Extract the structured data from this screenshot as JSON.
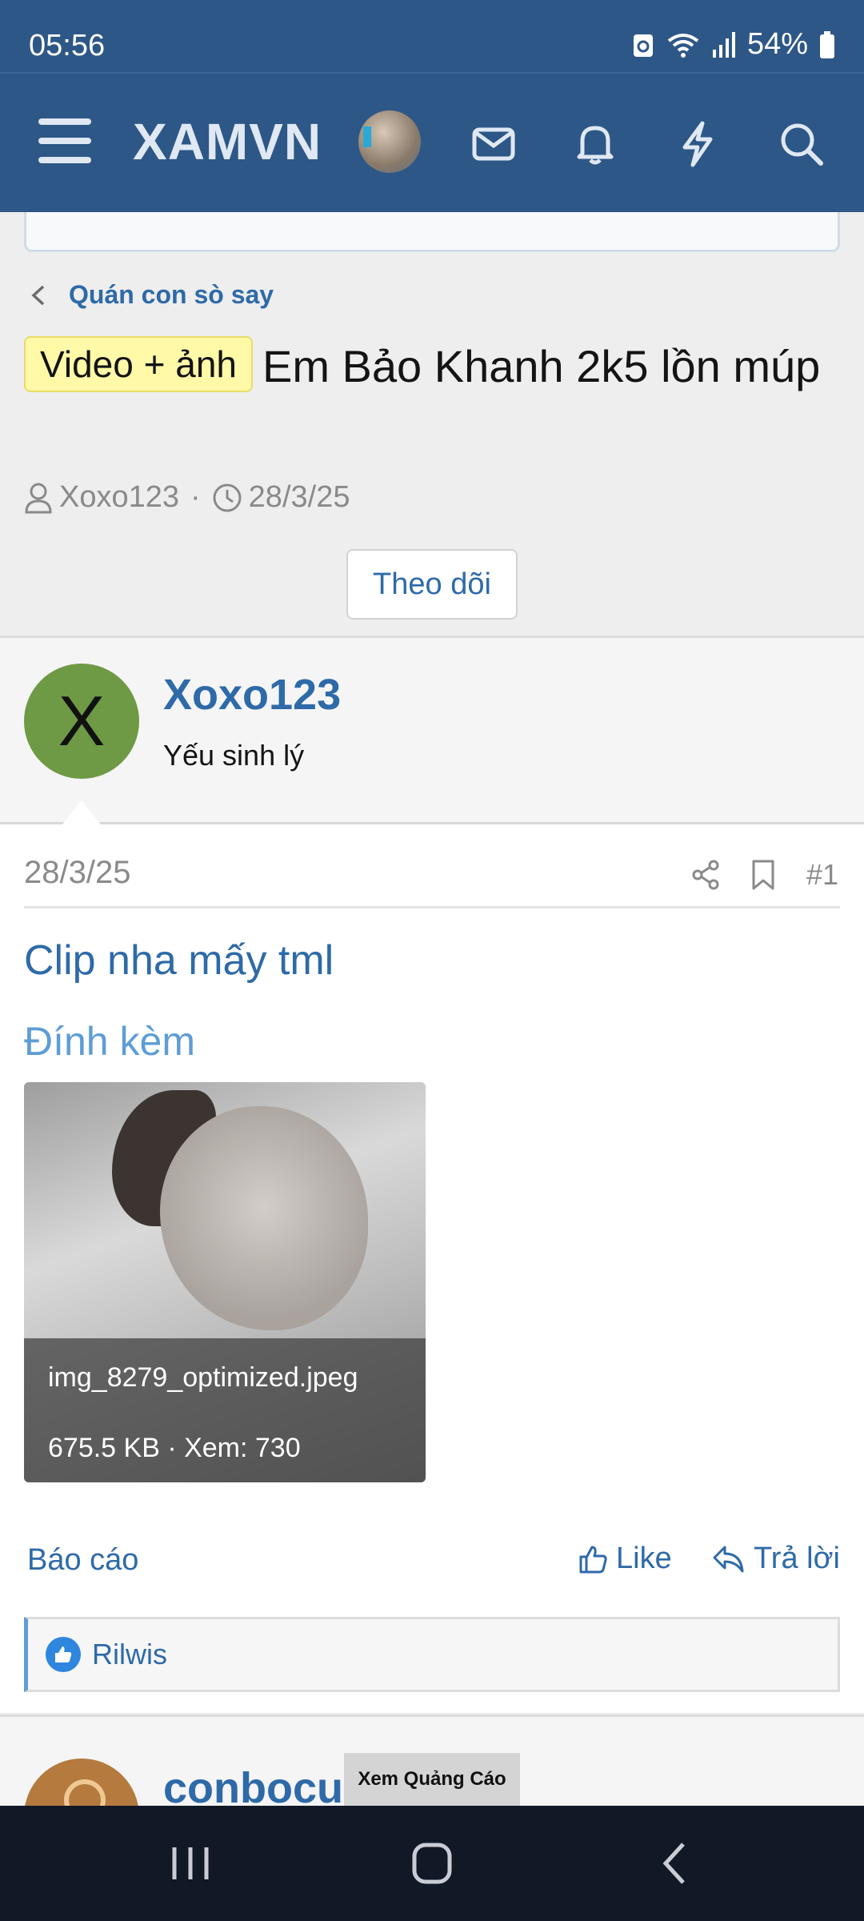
{
  "status": {
    "time": "05:56",
    "battery": "54%"
  },
  "header": {
    "brand": "XAMVN",
    "icons": [
      "menu-icon",
      "mail-icon",
      "bell-icon",
      "bolt-icon",
      "search-icon"
    ]
  },
  "breadcrumb": {
    "label": "Quán con sò say"
  },
  "thread": {
    "tag": "Video + ảnh",
    "title": "Em Bảo Khanh 2k5 lồn múp",
    "author": "Xoxo123",
    "date": "28/3/25",
    "follow_label": "Theo dõi"
  },
  "user": {
    "initial": "X",
    "name": "Xoxo123",
    "title": "Yếu sinh lý",
    "avatar_color": "#6f9a45"
  },
  "post": {
    "date": "28/3/25",
    "number": "#1",
    "body": "Clip nha mấy tml",
    "attachments_heading": "Đính kèm",
    "attachment": {
      "filename": "img_8279_optimized.jpeg",
      "info": "675.5 KB · Xem: 730"
    },
    "report_label": "Báo cáo",
    "like_label": "Like",
    "reply_label": "Trả lời",
    "liked_by": "Rilwis"
  },
  "next_post": {
    "name": "conbocuc"
  },
  "ad": {
    "label": "Xem Quảng Cáo"
  },
  "colors": {
    "header_bg": "#2d5787",
    "link": "#2e6aa8",
    "accent": "#5d9dd6"
  }
}
